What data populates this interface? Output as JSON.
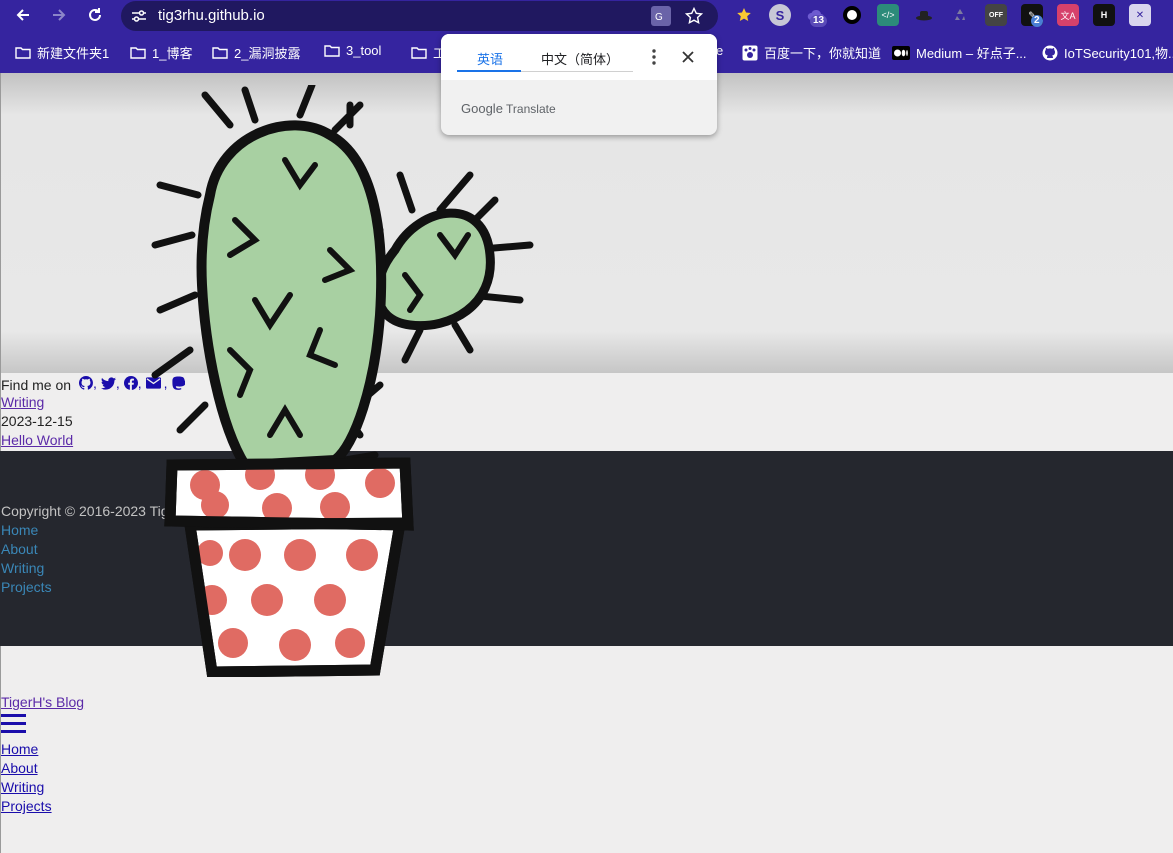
{
  "browser": {
    "url": "tig3rhu.github.io",
    "extension_badges": {
      "ext_3": "13",
      "ext_10": "2"
    },
    "bookmarks": [
      {
        "label": "新建文件夹1",
        "icon": "folder-icon"
      },
      {
        "label": "1_博客",
        "icon": "folder-icon"
      },
      {
        "label": "2_漏洞披露",
        "icon": "folder-icon"
      },
      {
        "label": "3_tool",
        "icon": "folder-icon"
      },
      {
        "label": "工",
        "icon": "folder-icon"
      },
      {
        "label": "e",
        "icon": ""
      },
      {
        "label": "百度一下，你就知道",
        "icon": "baidu-icon"
      },
      {
        "label": "Medium – 好点子...",
        "icon": "medium-icon"
      },
      {
        "label": "IoTSecurity101,物...",
        "icon": "github-icon"
      }
    ]
  },
  "translate_popup": {
    "tab_source": "英语",
    "tab_target": "中文（简体）",
    "brand": "Google",
    "product": "Translate"
  },
  "page": {
    "find_me_label": "Find me on",
    "social_separators": [
      ",",
      ",",
      ",",
      ","
    ],
    "category_link": "Writing",
    "post_date": "2023-12-15",
    "post_title": "Hello World",
    "copyright": "Copyright © 2016-2023 Tig",
    "footer_links": [
      "Home",
      "About",
      "Writing",
      "Projects"
    ],
    "blog_title": "TigerH's Blog",
    "nav_links": [
      "Home",
      "About",
      "Writing",
      "Projects"
    ]
  },
  "colors": {
    "browser_frame": "#35249f",
    "footer_bg": "#25272e",
    "footer_link": "#3a87b7",
    "cactus_green": "#a8d0a2",
    "pot_dot": "#e06b63"
  }
}
